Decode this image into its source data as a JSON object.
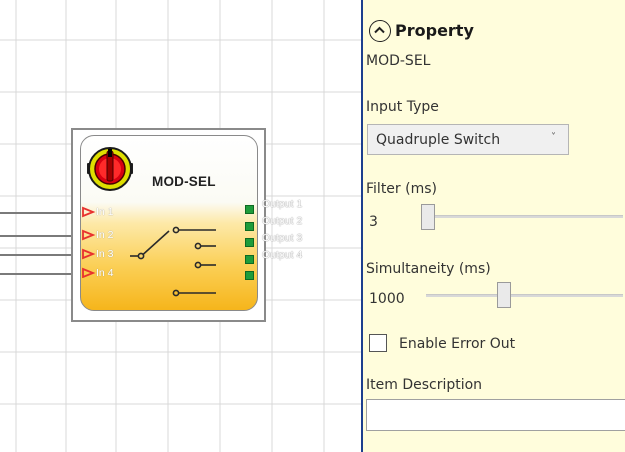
{
  "colors": {
    "panel_bg": "#fffddc",
    "divider": "#1d3f8e",
    "grid_line": "#d9d9d9",
    "output_port": "#1e9c3a",
    "input_port_marker": "#e8312e",
    "block_orange": "#f6b51b"
  },
  "canvas": {
    "block": {
      "title": "MOD-SEL",
      "icon": "rotary-selector-icon",
      "inputs": [
        "In 1",
        "In 2",
        "In 3",
        "In 4"
      ],
      "outputs": [
        "Output 1",
        "Output 2",
        "Output 3",
        "Output 4"
      ]
    }
  },
  "panel": {
    "header": {
      "title": "Property",
      "icon": "chevron-up-circle-icon"
    },
    "block_name": "MOD-SEL",
    "input_type": {
      "label": "Input Type",
      "value": "Quadruple Switch",
      "caret": "˅"
    },
    "filter": {
      "label": "Filter (ms)",
      "value": "3"
    },
    "simultaneity": {
      "label": "Simultaneity (ms)",
      "value": "1000"
    },
    "enable_error_out": {
      "label": "Enable Error Out",
      "checked": false
    },
    "item_description": {
      "label": "Item Description",
      "value": ""
    }
  }
}
